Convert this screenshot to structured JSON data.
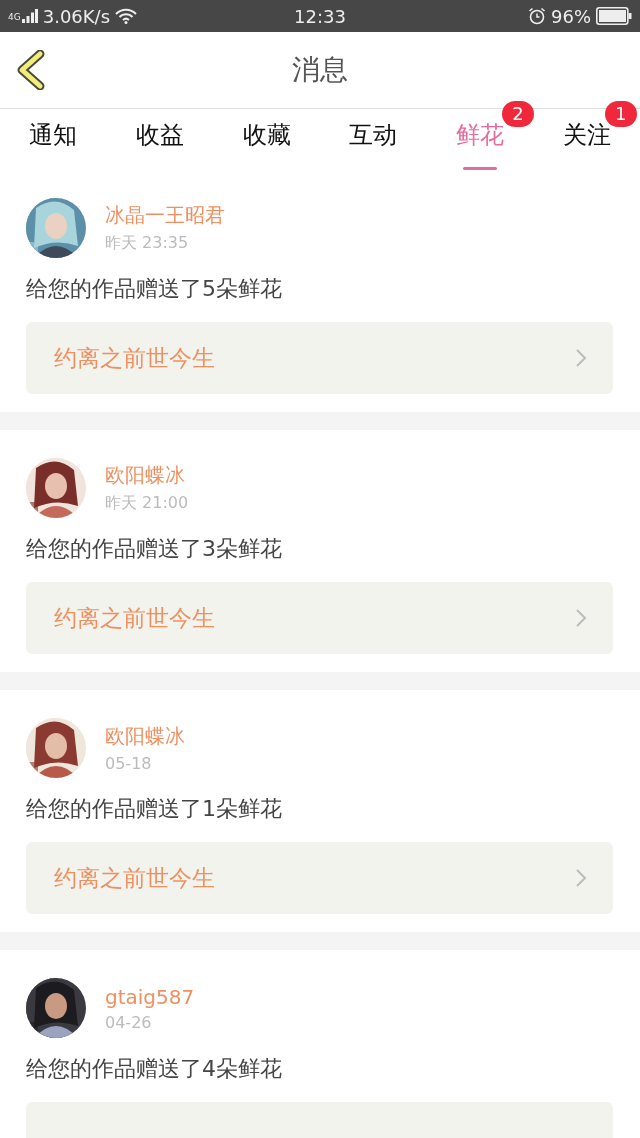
{
  "status_bar": {
    "network": "4G",
    "speed": "3.06K/s",
    "time": "12:33",
    "battery": "96%"
  },
  "header": {
    "title": "消息"
  },
  "tabs": [
    {
      "label": "通知",
      "selected": false
    },
    {
      "label": "收益",
      "selected": false
    },
    {
      "label": "收藏",
      "selected": false
    },
    {
      "label": "互动",
      "selected": false
    },
    {
      "label": "鲜花",
      "selected": true,
      "badge": "2"
    },
    {
      "label": "关注",
      "selected": false,
      "badge": "1"
    }
  ],
  "messages": [
    {
      "name": "冰晶一王昭君",
      "time": "昨天 23:35",
      "text": "给您的作品赠送了5朵鲜花",
      "work": "约离之前世今生"
    },
    {
      "name": "欧阳蝶冰",
      "time": "昨天 21:00",
      "text": "给您的作品赠送了3朵鲜花",
      "work": "约离之前世今生"
    },
    {
      "name": "欧阳蝶冰",
      "time": "05-18",
      "text": "给您的作品赠送了1朵鲜花",
      "work": "约离之前世今生"
    },
    {
      "name": "gtaig587",
      "time": "04-26",
      "text": "给您的作品赠送了4朵鲜花"
    }
  ]
}
